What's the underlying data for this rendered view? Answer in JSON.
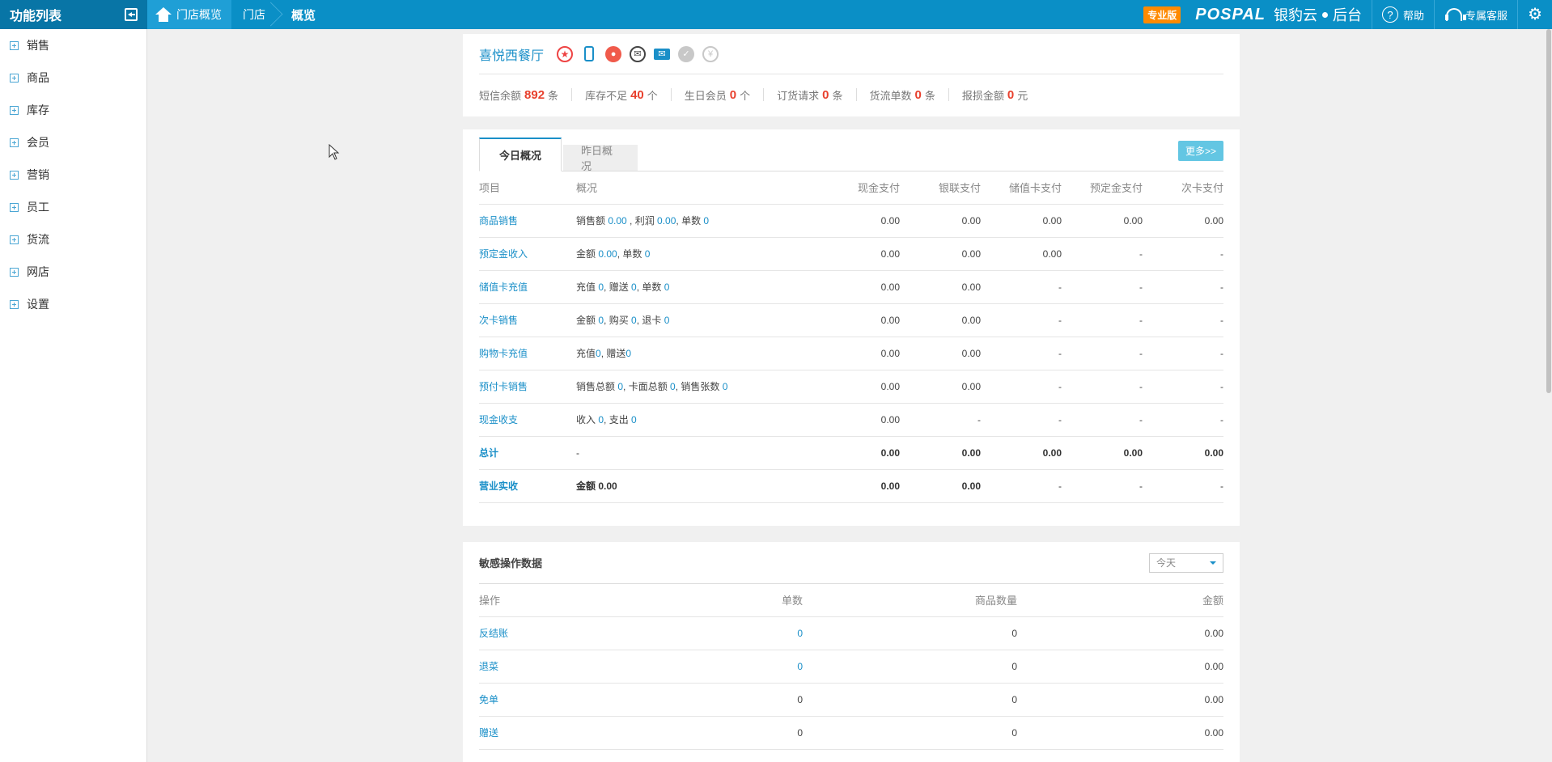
{
  "topbar": {
    "menu_title": "功能列表",
    "breadcrumb": [
      "门店概览",
      "门店",
      "概览"
    ],
    "badge": "专业版",
    "logo_en": "POSPAL",
    "logo_cn_1": "银豹云",
    "logo_cn_2": "后台",
    "help": "帮助",
    "service": "专属客服"
  },
  "sidebar": {
    "items": [
      "销售",
      "商品",
      "库存",
      "会员",
      "营销",
      "员工",
      "货流",
      "网店",
      "设置"
    ]
  },
  "store": {
    "name": "喜悦西餐厅",
    "stats": [
      {
        "label": "短信余额",
        "value": "892",
        "unit": "条"
      },
      {
        "label": "库存不足",
        "value": "40",
        "unit": "个"
      },
      {
        "label": "生日会员",
        "value": "0",
        "unit": "个"
      },
      {
        "label": "订货请求",
        "value": "0",
        "unit": "条"
      },
      {
        "label": "货流单数",
        "value": "0",
        "unit": "条"
      },
      {
        "label": "报损金额",
        "value": "0",
        "unit": "元"
      }
    ]
  },
  "overview": {
    "tabs": [
      "今日概况",
      "昨日概况"
    ],
    "more": "更多>>",
    "headers": [
      "项目",
      "概况",
      "现金支付",
      "银联支付",
      "储值卡支付",
      "预定金支付",
      "次卡支付"
    ],
    "rows": [
      {
        "item": "商品销售",
        "summary": [
          [
            "销售额 ",
            "0.00"
          ],
          [
            " , 利润 ",
            "0.00"
          ],
          [
            ", 单数 ",
            "0"
          ]
        ],
        "cash": "0.00",
        "union": "0.00",
        "stored": "0.00",
        "deposit": "0.00",
        "times": "0.00"
      },
      {
        "item": "预定金收入",
        "summary": [
          [
            "金额 ",
            "0.00"
          ],
          [
            ", 单数 ",
            "0"
          ]
        ],
        "cash": "0.00",
        "union": "0.00",
        "stored": "0.00",
        "deposit": "-",
        "times": "-"
      },
      {
        "item": "储值卡充值",
        "summary": [
          [
            "充值 ",
            "0"
          ],
          [
            ", 赠送 ",
            "0"
          ],
          [
            ", 单数 ",
            "0"
          ]
        ],
        "cash": "0.00",
        "union": "0.00",
        "stored": "-",
        "deposit": "-",
        "times": "-"
      },
      {
        "item": "次卡销售",
        "summary": [
          [
            "金额 ",
            "0"
          ],
          [
            ", 购买 ",
            "0"
          ],
          [
            ", 退卡 ",
            "0"
          ]
        ],
        "cash": "0.00",
        "union": "0.00",
        "stored": "-",
        "deposit": "-",
        "times": "-"
      },
      {
        "item": "购物卡充值",
        "summary": [
          [
            "充值",
            "0"
          ],
          [
            ", 赠送",
            "0"
          ]
        ],
        "cash": "0.00",
        "union": "0.00",
        "stored": "-",
        "deposit": "-",
        "times": "-"
      },
      {
        "item": "预付卡销售",
        "summary": [
          [
            "销售总额 ",
            "0"
          ],
          [
            ", 卡面总额 ",
            "0"
          ],
          [
            ", 销售张数 ",
            "0"
          ]
        ],
        "cash": "0.00",
        "union": "0.00",
        "stored": "-",
        "deposit": "-",
        "times": "-"
      },
      {
        "item": "现金收支",
        "summary": [
          [
            "收入 ",
            "0"
          ],
          [
            ", 支出 ",
            "0"
          ]
        ],
        "cash": "0.00",
        "union": "-",
        "stored": "-",
        "deposit": "-",
        "times": "-"
      }
    ],
    "total": {
      "item": "总计",
      "summary": "-",
      "cash": "0.00",
      "union": "0.00",
      "stored": "0.00",
      "deposit": "0.00",
      "times": "0.00"
    },
    "revenue": {
      "item": "营业实收",
      "summary": "金额 0.00",
      "cash": "0.00",
      "union": "0.00",
      "stored": "-",
      "deposit": "-",
      "times": "-"
    }
  },
  "sensitive": {
    "title": "敏感操作数据",
    "period": "今天",
    "headers": [
      "操作",
      "单数",
      "商品数量",
      "金额"
    ],
    "rows": [
      {
        "op": "反结账",
        "count": "0",
        "count_link": true,
        "qty": "0",
        "amount": "0.00"
      },
      {
        "op": "退菜",
        "count": "0",
        "count_link": true,
        "qty": "0",
        "amount": "0.00"
      },
      {
        "op": "免单",
        "count": "0",
        "count_link": false,
        "qty": "0",
        "amount": "0.00"
      },
      {
        "op": "赠送",
        "count": "0",
        "count_link": false,
        "qty": "0",
        "amount": "0.00"
      }
    ]
  }
}
